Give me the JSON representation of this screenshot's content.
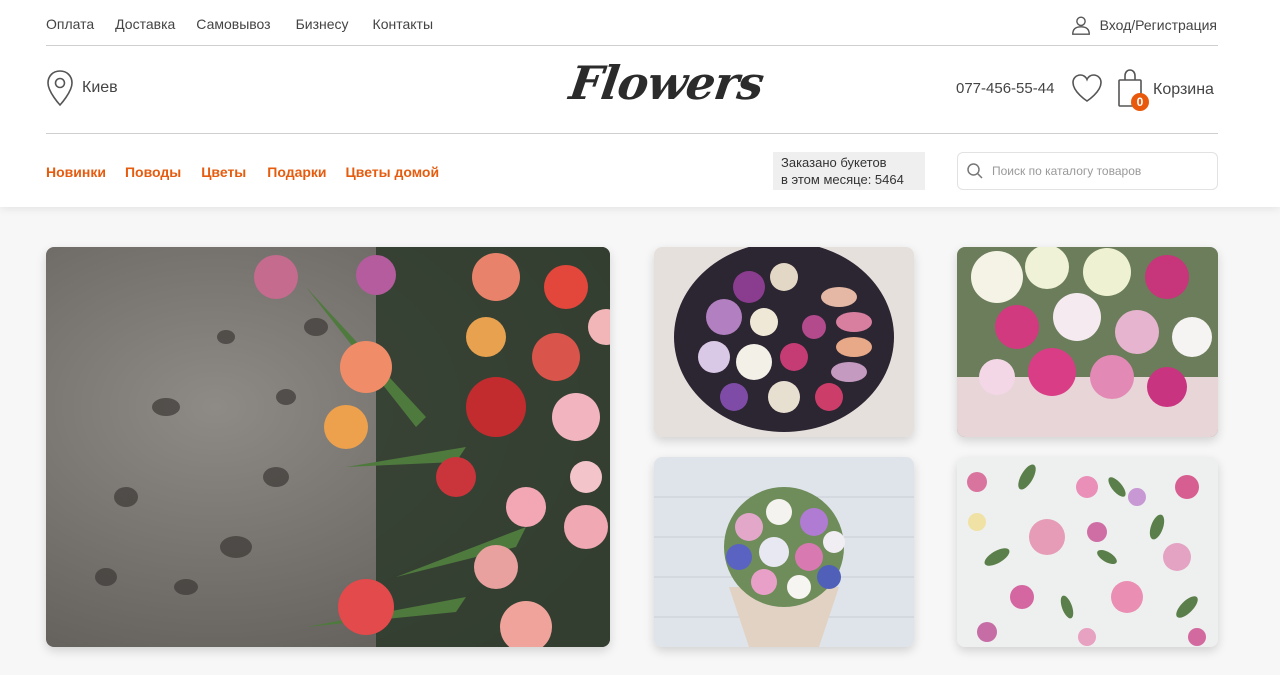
{
  "top_nav": {
    "items": [
      {
        "label": "Оплата"
      },
      {
        "label": "Доставка"
      },
      {
        "label": "Самовывоз"
      },
      {
        "label": "Бизнесу"
      },
      {
        "label": "Контакты"
      }
    ],
    "login_label": "Вход/Регистрация"
  },
  "header": {
    "city": "Киев",
    "logo": "Flowers",
    "phone": "077-456-55-44",
    "cart_count": "0",
    "cart_label": "Корзина"
  },
  "category_nav": {
    "items": [
      {
        "label": "Новинки"
      },
      {
        "label": "Поводы"
      },
      {
        "label": "Цветы"
      },
      {
        "label": "Подарки"
      },
      {
        "label": "Цветы домой"
      }
    ]
  },
  "counter": {
    "line1": "Заказано букетов",
    "line2": "в этом месяце: 5464"
  },
  "search": {
    "placeholder": "Поиск по каталогу товаров",
    "value": ""
  },
  "colors": {
    "accent": "#e65c0f",
    "badge": "#e8590c",
    "text": "#444444"
  },
  "icons": {
    "user": "user-icon",
    "location": "location-pin-icon",
    "favorites": "heart-icon",
    "cart": "shopping-bag-icon",
    "search": "search-icon"
  }
}
